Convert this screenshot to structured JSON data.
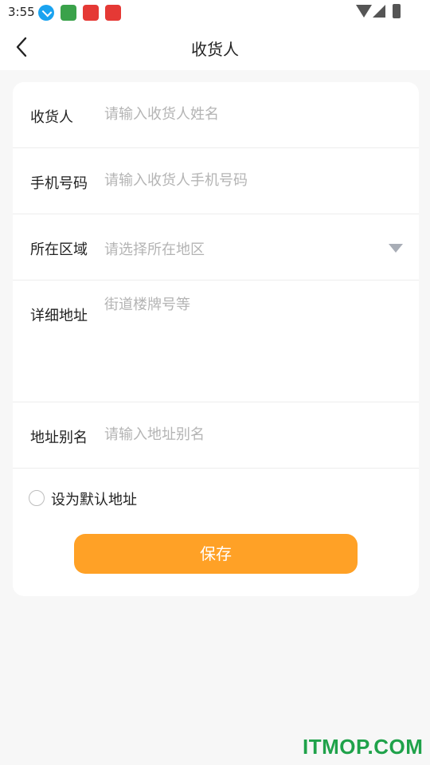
{
  "status_bar": {
    "time": "3:55"
  },
  "header": {
    "title": "收货人"
  },
  "form": {
    "name": {
      "label": "收货人",
      "placeholder": "请输入收货人姓名"
    },
    "phone": {
      "label": "手机号码",
      "placeholder": "请输入收货人手机号码"
    },
    "region": {
      "label": "所在区域",
      "placeholder": "请选择所在地区"
    },
    "detail": {
      "label": "详细地址",
      "placeholder": "街道楼牌号等"
    },
    "alias": {
      "label": "地址别名",
      "placeholder": "请输入地址别名"
    },
    "default_label": "设为默认地址",
    "default_checked": false,
    "save_label": "保存"
  },
  "colors": {
    "accent": "#ffa126",
    "placeholder": "#b4b4b4",
    "background": "#f7f7f7"
  },
  "watermark": "ITMOP.COM"
}
